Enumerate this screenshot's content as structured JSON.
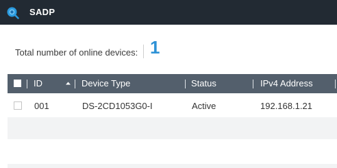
{
  "window": {
    "app_title": "SADP",
    "logo_icon": "sadp-logo-icon"
  },
  "summary": {
    "total_label": "Total number of online devices:",
    "total_count": "1"
  },
  "table": {
    "columns": [
      "ID",
      "Device Type",
      "Status",
      "IPv4 Address"
    ],
    "sort_icon": "sort-ascending-icon",
    "rows": [
      {
        "id": "001",
        "device_type": "DS-2CD1053G0-I",
        "status": "Active",
        "ipv4": "192.168.1.21"
      }
    ]
  },
  "colors": {
    "titlebar": "#222a33",
    "table_header": "#535f6c",
    "count_accent": "#2e92d6"
  }
}
